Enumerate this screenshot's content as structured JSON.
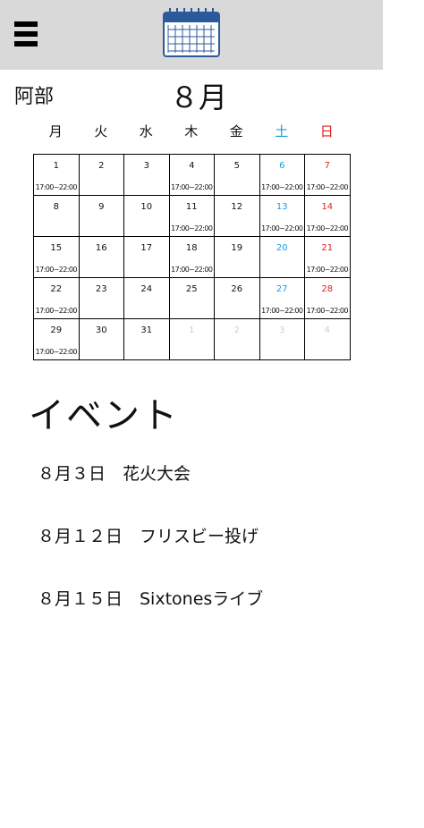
{
  "header": {
    "menu_icon": "hamburger-menu-icon",
    "calendar_icon": "calendar-icon"
  },
  "user": {
    "name": "阿部"
  },
  "calendar": {
    "month_label": "８月",
    "weekdays": [
      "月",
      "火",
      "水",
      "木",
      "金",
      "土",
      "日"
    ],
    "colors": {
      "saturday": "#1a9be0",
      "sunday": "#e02020",
      "muted": "#cfcfcf"
    },
    "days": [
      {
        "label": "1",
        "time": "17:00~22:00"
      },
      {
        "label": "2",
        "time": ""
      },
      {
        "label": "3",
        "time": ""
      },
      {
        "label": "4",
        "time": "17:00~22:00"
      },
      {
        "label": "5",
        "time": ""
      },
      {
        "label": "6",
        "time": "17:00~22:00"
      },
      {
        "label": "7",
        "time": "17:00~22:00"
      },
      {
        "label": "8",
        "time": ""
      },
      {
        "label": "9",
        "time": ""
      },
      {
        "label": "10",
        "time": ""
      },
      {
        "label": "11",
        "time": "17:00~22:00"
      },
      {
        "label": "12",
        "time": ""
      },
      {
        "label": "13",
        "time": "17:00~22:00"
      },
      {
        "label": "14",
        "time": "17:00~22:00"
      },
      {
        "label": "15",
        "time": "17:00~22:00"
      },
      {
        "label": "16",
        "time": ""
      },
      {
        "label": "17",
        "time": ""
      },
      {
        "label": "18",
        "time": "17:00~22:00"
      },
      {
        "label": "19",
        "time": ""
      },
      {
        "label": "20",
        "time": ""
      },
      {
        "label": "21",
        "time": "17:00~22:00"
      },
      {
        "label": "22",
        "time": "17:00~22:00"
      },
      {
        "label": "23",
        "time": ""
      },
      {
        "label": "24",
        "time": ""
      },
      {
        "label": "25",
        "time": ""
      },
      {
        "label": "26",
        "time": ""
      },
      {
        "label": "27",
        "time": "17:00~22:00"
      },
      {
        "label": "28",
        "time": "17:00~22:00"
      },
      {
        "label": "29",
        "time": "17:00~22:00"
      },
      {
        "label": "30",
        "time": ""
      },
      {
        "label": "31",
        "time": ""
      },
      {
        "label": "1",
        "time": ""
      },
      {
        "label": "2",
        "time": ""
      },
      {
        "label": "3",
        "time": ""
      },
      {
        "label": "4",
        "time": ""
      }
    ]
  },
  "events": {
    "title": "イベント",
    "items": [
      "８月３日　花火大会",
      "８月１２日　フリスビー投げ",
      "８月１５日　Sixtonesライブ"
    ]
  }
}
